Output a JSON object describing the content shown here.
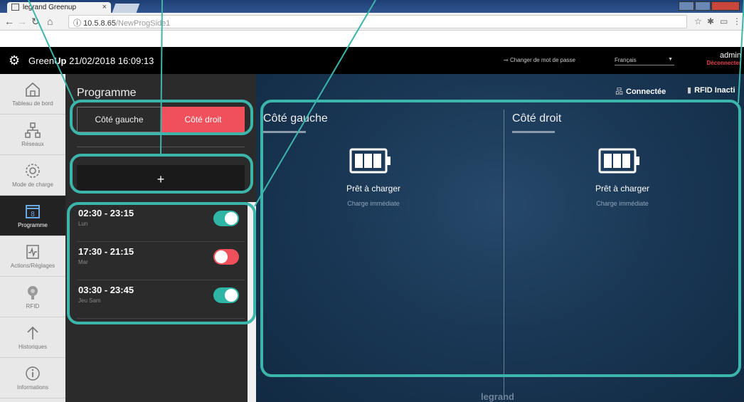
{
  "browser": {
    "tab_title": "legrand Greenup",
    "url_host": "10.5.8.65",
    "url_path": "/NewProgSide1"
  },
  "header": {
    "brand_prefix": "Green",
    "brand_bold": "Up",
    "datetime": "21/02/2018 16:09:13",
    "change_password": "Changer de mot de passe",
    "language": "Français",
    "user": "admin",
    "logout": "Déconnecter"
  },
  "nav": {
    "items": [
      {
        "label": "Tableau de bord",
        "icon": "home-icon"
      },
      {
        "label": "Réseaux",
        "icon": "network-icon"
      },
      {
        "label": "Mode de charge",
        "icon": "gear-icon"
      },
      {
        "label": "Programme",
        "icon": "calendar-icon",
        "active": true
      },
      {
        "label": "Actions/Réglages",
        "icon": "activity-icon"
      },
      {
        "label": "RFID",
        "icon": "rfid-icon"
      },
      {
        "label": "Historiques",
        "icon": "upload-arrow-icon"
      },
      {
        "label": "Informations",
        "icon": "info-icon"
      }
    ]
  },
  "programme": {
    "title": "Programme",
    "left_side": "Côté gauche",
    "right_side": "Côté droit",
    "add_label": "+",
    "slots": [
      {
        "time": "02:30 - 23:15",
        "days": "Lun",
        "enabled": true
      },
      {
        "time": "17:30 - 21:15",
        "days": "Mar",
        "enabled": false
      },
      {
        "time": "03:30 - 23:45",
        "days": "Jeu Sam",
        "enabled": true
      }
    ]
  },
  "status": {
    "connected": "Connectée",
    "rfid": "RFID Inacti"
  },
  "sides": [
    {
      "name": "Côté gauche",
      "state": "Prêt à charger",
      "mode": "Charge immédiate"
    },
    {
      "name": "Côté droit",
      "state": "Prêt à charger",
      "mode": "Charge immédiate"
    }
  ],
  "footer": "legrand",
  "colors": {
    "accent_red": "#f0505c",
    "toggle_on": "#2fb5a5",
    "annotation": "#3cb5aa"
  }
}
